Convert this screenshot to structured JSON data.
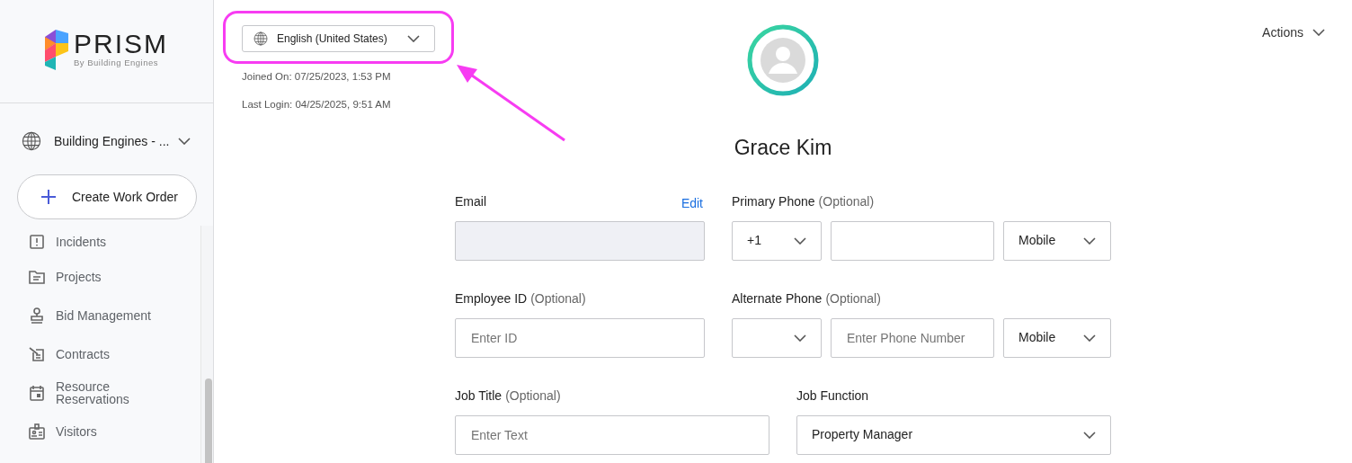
{
  "sidebar": {
    "logo": {
      "name": "PRISM",
      "tagline": "By Building Engines"
    },
    "site_selector": {
      "label": "Building Engines - ..."
    },
    "create_button": {
      "label": "Create Work Order"
    },
    "nav_items": [
      {
        "label": "Incidents"
      },
      {
        "label": "Projects"
      },
      {
        "label": "Bid Management"
      },
      {
        "label": "Contracts"
      },
      {
        "label": "Resource Reservations"
      },
      {
        "label": "Visitors"
      }
    ]
  },
  "profile": {
    "language": "English (United States)",
    "joined": "Joined On: 07/25/2023, 1:53 PM",
    "last_login": "Last Login: 04/25/2025, 9:51 AM",
    "actions": "Actions",
    "name": "Grace Kim"
  },
  "form": {
    "email": {
      "label": "Email",
      "edit_link": "Edit"
    },
    "primary_phone": {
      "label": "Primary Phone",
      "optional": "(Optional)",
      "country_code": "+1",
      "type": "Mobile"
    },
    "employee_id": {
      "label": "Employee ID",
      "optional": "(Optional)",
      "placeholder": "Enter ID"
    },
    "alternate_phone": {
      "label": "Alternate Phone",
      "optional": "(Optional)",
      "number_placeholder": "Enter Phone Number",
      "type": "Mobile"
    },
    "job_title": {
      "label": "Job Title",
      "optional": "(Optional)",
      "placeholder": "Enter Text"
    },
    "job_function": {
      "label": "Job Function",
      "value": "Property Manager"
    }
  }
}
